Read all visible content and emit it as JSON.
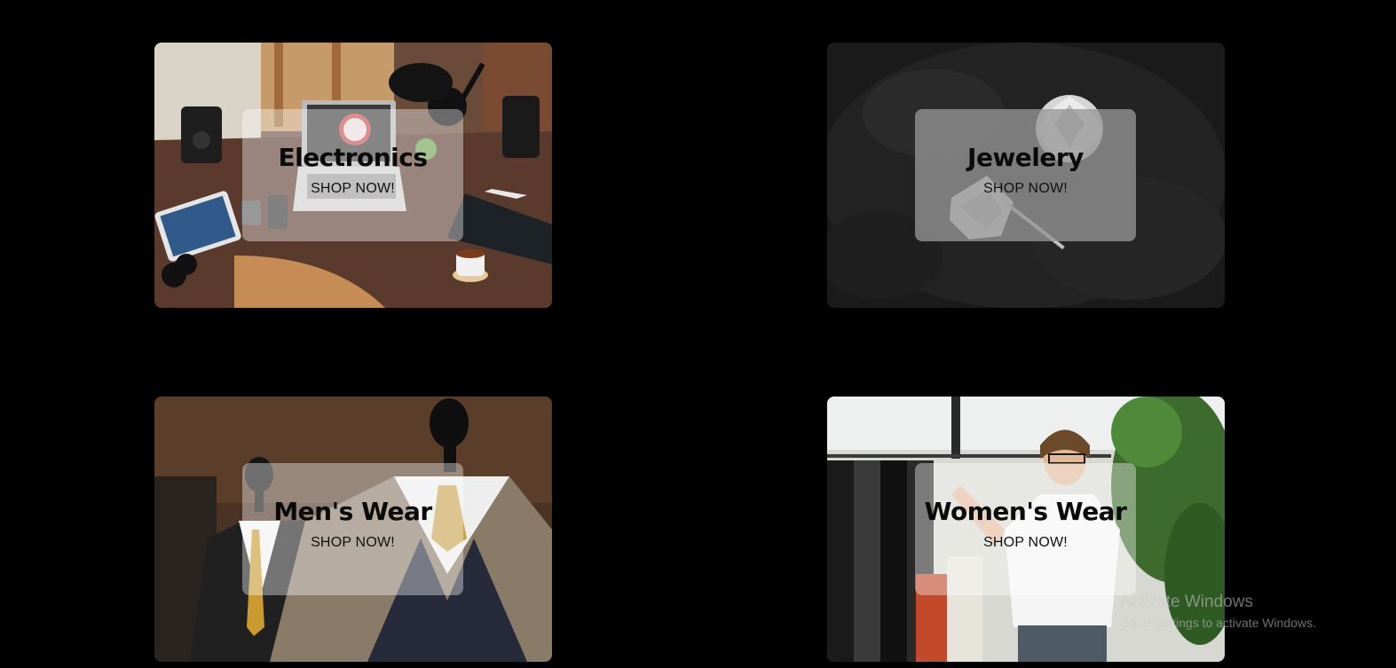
{
  "categories": [
    {
      "title": "Electronics",
      "cta": "SHOP NOW!"
    },
    {
      "title": "Jewelery",
      "cta": "SHOP NOW!"
    },
    {
      "title": "Men's Wear",
      "cta": "SHOP NOW!"
    },
    {
      "title": "Women's Wear",
      "cta": "SHOP NOW!"
    }
  ],
  "watermark": {
    "title": "Activate Windows",
    "subtitle": "Go to Settings to activate Windows."
  },
  "colors": {
    "page_background": "#000000",
    "overlay_light": "rgba(255,255,255,0.38)",
    "overlay_jewelery": "rgba(150,150,150,0.78)",
    "text": "#0a0a0a"
  },
  "icons": [
    "desk-photo",
    "diamond-photo",
    "suit-photo",
    "clothes-rack-photo"
  ]
}
